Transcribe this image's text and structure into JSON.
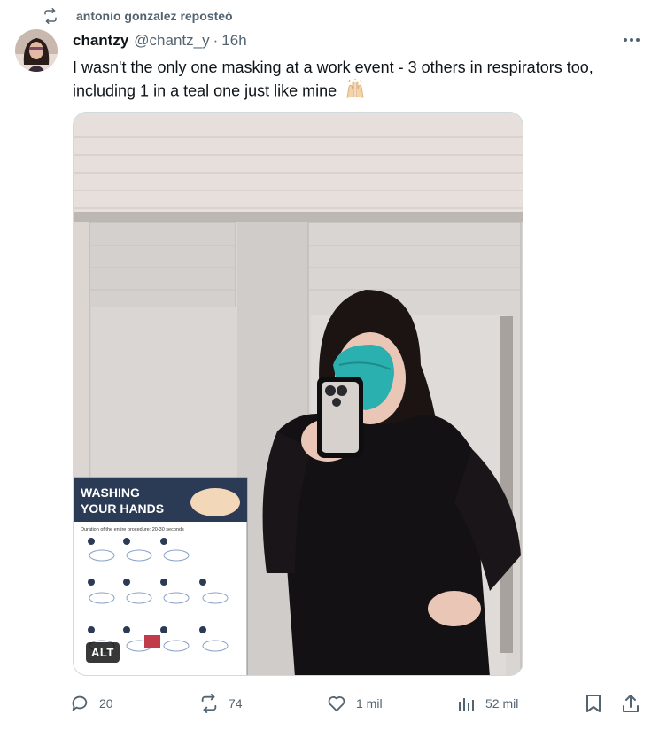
{
  "repost": {
    "label": "antonio gonzalez reposteó",
    "icon": "repost-icon"
  },
  "author": {
    "name": "chantzy",
    "handle": "@chantz_y",
    "separator": "·",
    "time": "16h"
  },
  "tweet": {
    "text_line1": "I wasn't the only one masking at a work event - 3 others in respirators too,",
    "text_line2": "including 1 in a teal one just like mine",
    "emoji": "raising-hands-emoji"
  },
  "media": {
    "alt_badge": "ALT",
    "poster_title_line1": "WASHING",
    "poster_title_line2": "YOUR HANDS",
    "poster_subtitle": "Duration of the entire procedure: 20-30 seconds"
  },
  "actions": {
    "replies": "20",
    "reposts": "74",
    "likes": "1 mil",
    "views": "52 mil"
  },
  "colors": {
    "secondary_text": "#536471",
    "mask_teal": "#2bb0b0",
    "poster_navy": "#2b3a55"
  }
}
